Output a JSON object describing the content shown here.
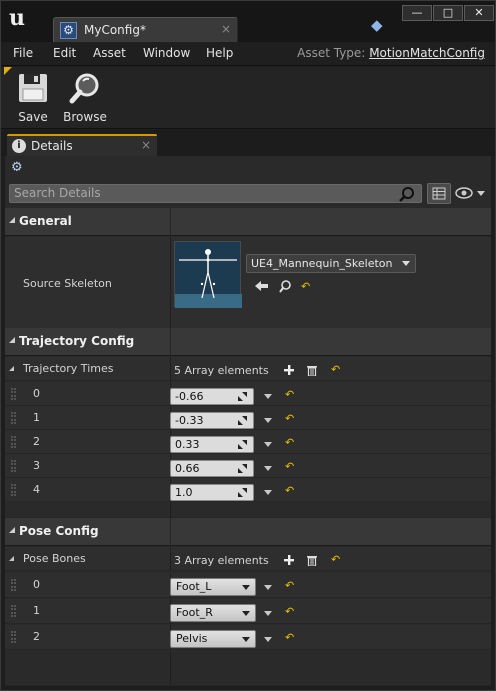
{
  "window": {
    "doc_tab_label": "MyConfig*",
    "tab_close": "×",
    "min": "—",
    "max": "□",
    "close": "✕"
  },
  "menu": {
    "items": [
      "File",
      "Edit",
      "Asset",
      "Window",
      "Help"
    ],
    "asset_type_label": "Asset Type:",
    "asset_type_value": "MotionMatchConfig"
  },
  "toolbar": {
    "save_label": "Save",
    "browse_label": "Browse"
  },
  "details_tab": {
    "label": "Details",
    "close": "×"
  },
  "search": {
    "placeholder": "Search Details"
  },
  "sections": {
    "general": {
      "title": "General",
      "source_skeleton_label": "Source Skeleton",
      "source_skeleton_value": "UE4_Mannequin_Skeleton"
    },
    "trajectory": {
      "title": "Trajectory Config",
      "array_label": "Trajectory Times",
      "array_count": "5 Array elements",
      "elements": [
        {
          "index": "0",
          "value": "-0.66"
        },
        {
          "index": "1",
          "value": "-0.33"
        },
        {
          "index": "2",
          "value": "0.33"
        },
        {
          "index": "3",
          "value": "0.66"
        },
        {
          "index": "4",
          "value": "1.0"
        }
      ]
    },
    "pose": {
      "title": "Pose Config",
      "array_label": "Pose Bones",
      "array_count": "3 Array elements",
      "elements": [
        {
          "index": "0",
          "value": "Foot_L"
        },
        {
          "index": "1",
          "value": "Foot_R"
        },
        {
          "index": "2",
          "value": "Pelvis"
        }
      ]
    }
  },
  "colors": {
    "accent": "#d09a00",
    "reset_arrow": "#e6c200",
    "thumbnail_bg": "#1c3a50"
  }
}
